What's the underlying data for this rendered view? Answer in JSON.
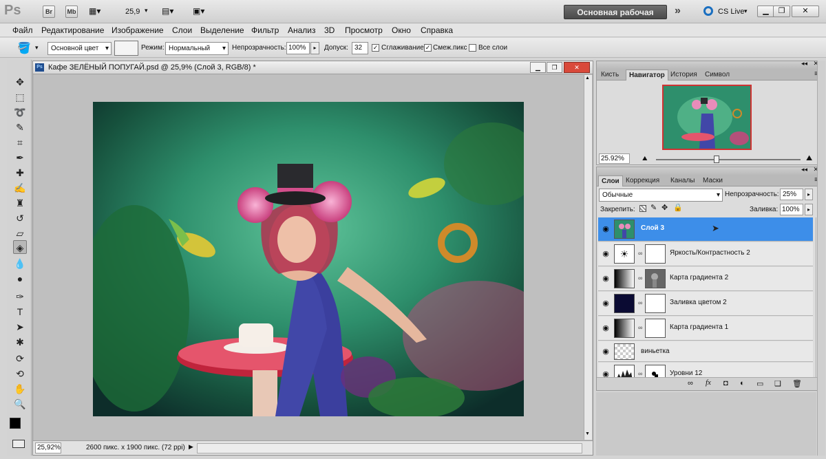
{
  "app": {
    "logo": "Ps",
    "bridge_label": "Br",
    "minibridge_label": "Mb",
    "zoom": "25,9",
    "workspace": "Основная рабочая среда",
    "cslive": "CS Live"
  },
  "menu": [
    "Файл",
    "Редактирование",
    "Изображение",
    "Слои",
    "Выделение",
    "Фильтр",
    "Анализ",
    "3D",
    "Просмотр",
    "Окно",
    "Справка"
  ],
  "options": {
    "fill_source": "Основной цвет",
    "mode_label": "Режим:",
    "mode_value": "Нормальный",
    "opacity_label": "Непрозрачность:",
    "opacity_value": "100%",
    "tolerance_label": "Допуск:",
    "tolerance_value": "32",
    "antialias_label": "Сглаживание",
    "contiguous_label": "Смеж.пикс",
    "all_layers_label": "Все слои"
  },
  "document": {
    "title": "Кафе ЗЕЛЁНЫЙ ПОПУГАЙ.psd @ 25,9% (Слой 3, RGB/8) *",
    "zoom": "25,92%",
    "info": "2600 пикс. x 1900 пикс. (72 ppi)"
  },
  "navigator": {
    "tabs": [
      "Кисть",
      "Навигатор",
      "История",
      "Символ"
    ],
    "active_tab": 1,
    "zoom": "25.92%",
    "slider_level": 0.42
  },
  "layers_panel": {
    "tabs": [
      "Слои",
      "Коррекция",
      "Каналы",
      "Маски"
    ],
    "active_tab": 0,
    "blend_mode": "Обычные",
    "opacity_label": "Непрозрачность:",
    "opacity_value": "25%",
    "lock_label": "Закрепить:",
    "fill_label": "Заливка:",
    "fill_value": "100%",
    "layers": [
      {
        "name": "Слой 3",
        "selected": true
      },
      {
        "name": "Яркость/Контрастность 2",
        "selected": false
      },
      {
        "name": "Карта градиента 2",
        "selected": false
      },
      {
        "name": "Заливка цветом 2",
        "selected": false
      },
      {
        "name": "Карта градиента 1",
        "selected": false
      },
      {
        "name": "виньетка",
        "selected": false
      },
      {
        "name": "Уровни 12",
        "selected": false
      }
    ]
  },
  "colors": {
    "selection": "#3d8ee9",
    "workspace_button": "#555555",
    "panel_bg": "#dcdcdc"
  }
}
